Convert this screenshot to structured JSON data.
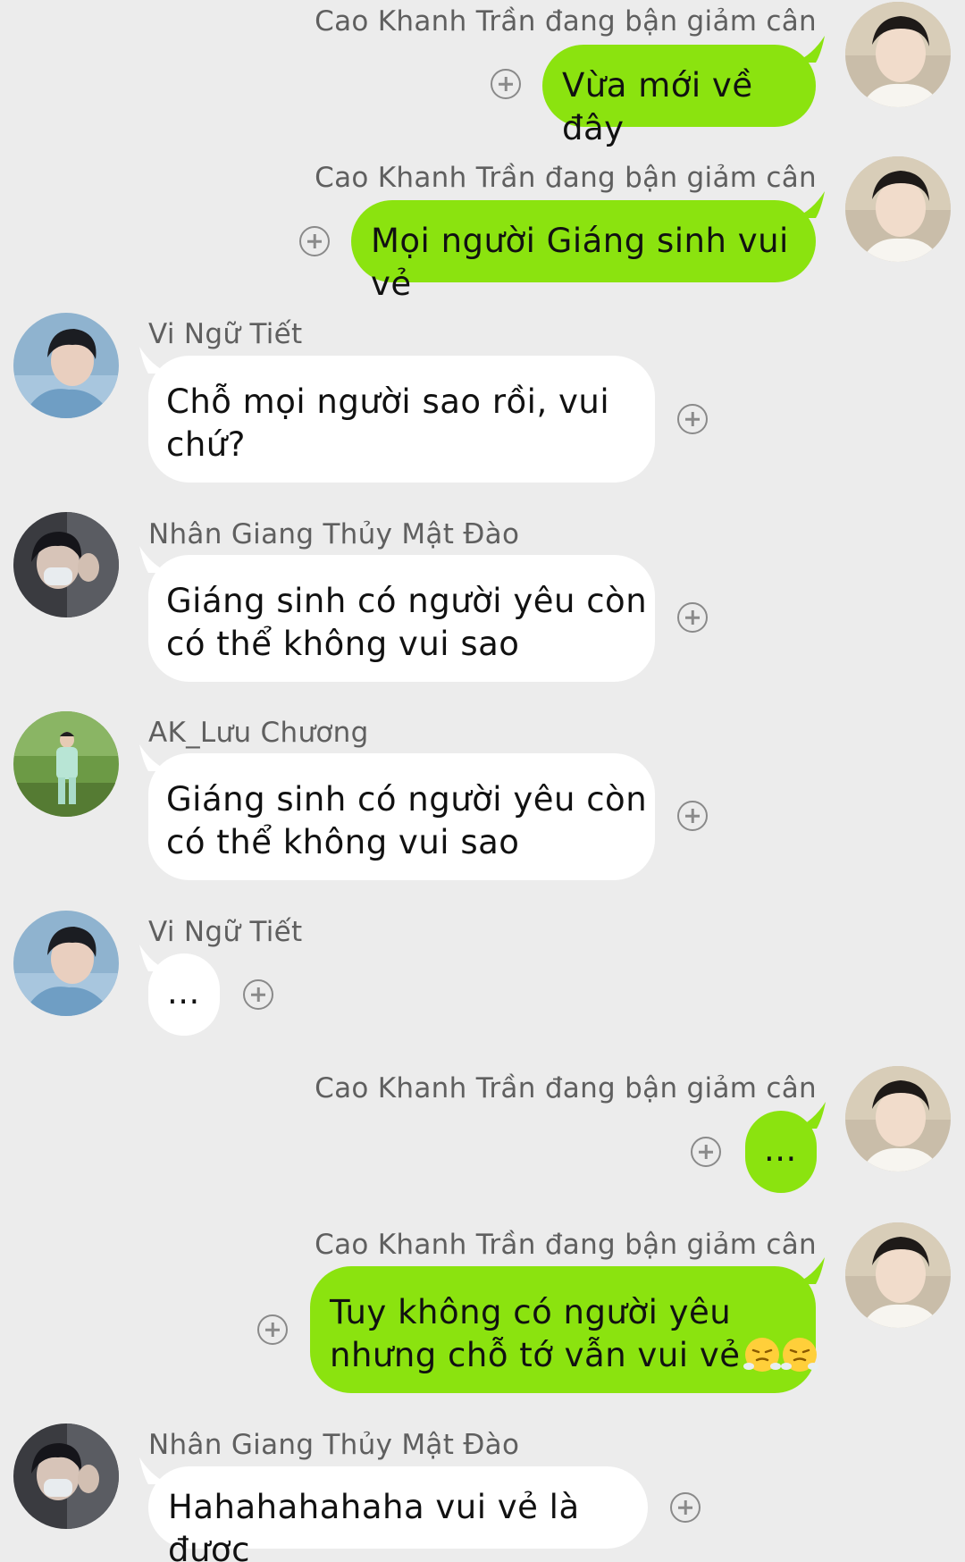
{
  "messages": [
    {
      "sender": "Cao Khanh Trần đang bận giảm cân",
      "text": "Vừa mới về đây",
      "direction": "outgoing"
    },
    {
      "sender": "Cao Khanh Trần đang bận giảm cân",
      "text": "Mọi người Giáng sinh vui vẻ",
      "direction": "outgoing"
    },
    {
      "sender": "Vi Ngữ Tiết",
      "text_line1": "Chỗ mọi người sao rồi, vui",
      "text_line2": "chứ?",
      "direction": "incoming"
    },
    {
      "sender": "Nhân Giang Thủy Mật Đào",
      "text_line1": "Giáng sinh có người yêu còn",
      "text_line2": "có thể không vui sao",
      "direction": "incoming"
    },
    {
      "sender": "AK_Lưu Chương",
      "text_line1": "Giáng sinh có người yêu còn",
      "text_line2": "có thể không vui sao",
      "direction": "incoming"
    },
    {
      "sender": "Vi Ngữ Tiết",
      "text": "...",
      "direction": "incoming"
    },
    {
      "sender": "Cao Khanh Trần đang bận giảm cân",
      "text": "...",
      "direction": "outgoing"
    },
    {
      "sender": "Cao Khanh Trần đang bận giảm cân",
      "text_line1": "Tuy không có người yêu",
      "text_line2": "nhưng chỗ tớ vẫn vui vẻ",
      "emoji": [
        "huffing-emoji",
        "huffing-emoji"
      ],
      "direction": "outgoing"
    },
    {
      "sender": "Nhân Giang Thủy Mật Đào",
      "text": "Hahahahahaha vui vẻ là được",
      "direction": "incoming"
    }
  ],
  "colors": {
    "background": "#ececec",
    "outgoing_bubble": "#8be30f",
    "incoming_bubble": "#ffffff",
    "sender_name": "#5f5f5f",
    "add_icon": "#8a8a8a"
  }
}
